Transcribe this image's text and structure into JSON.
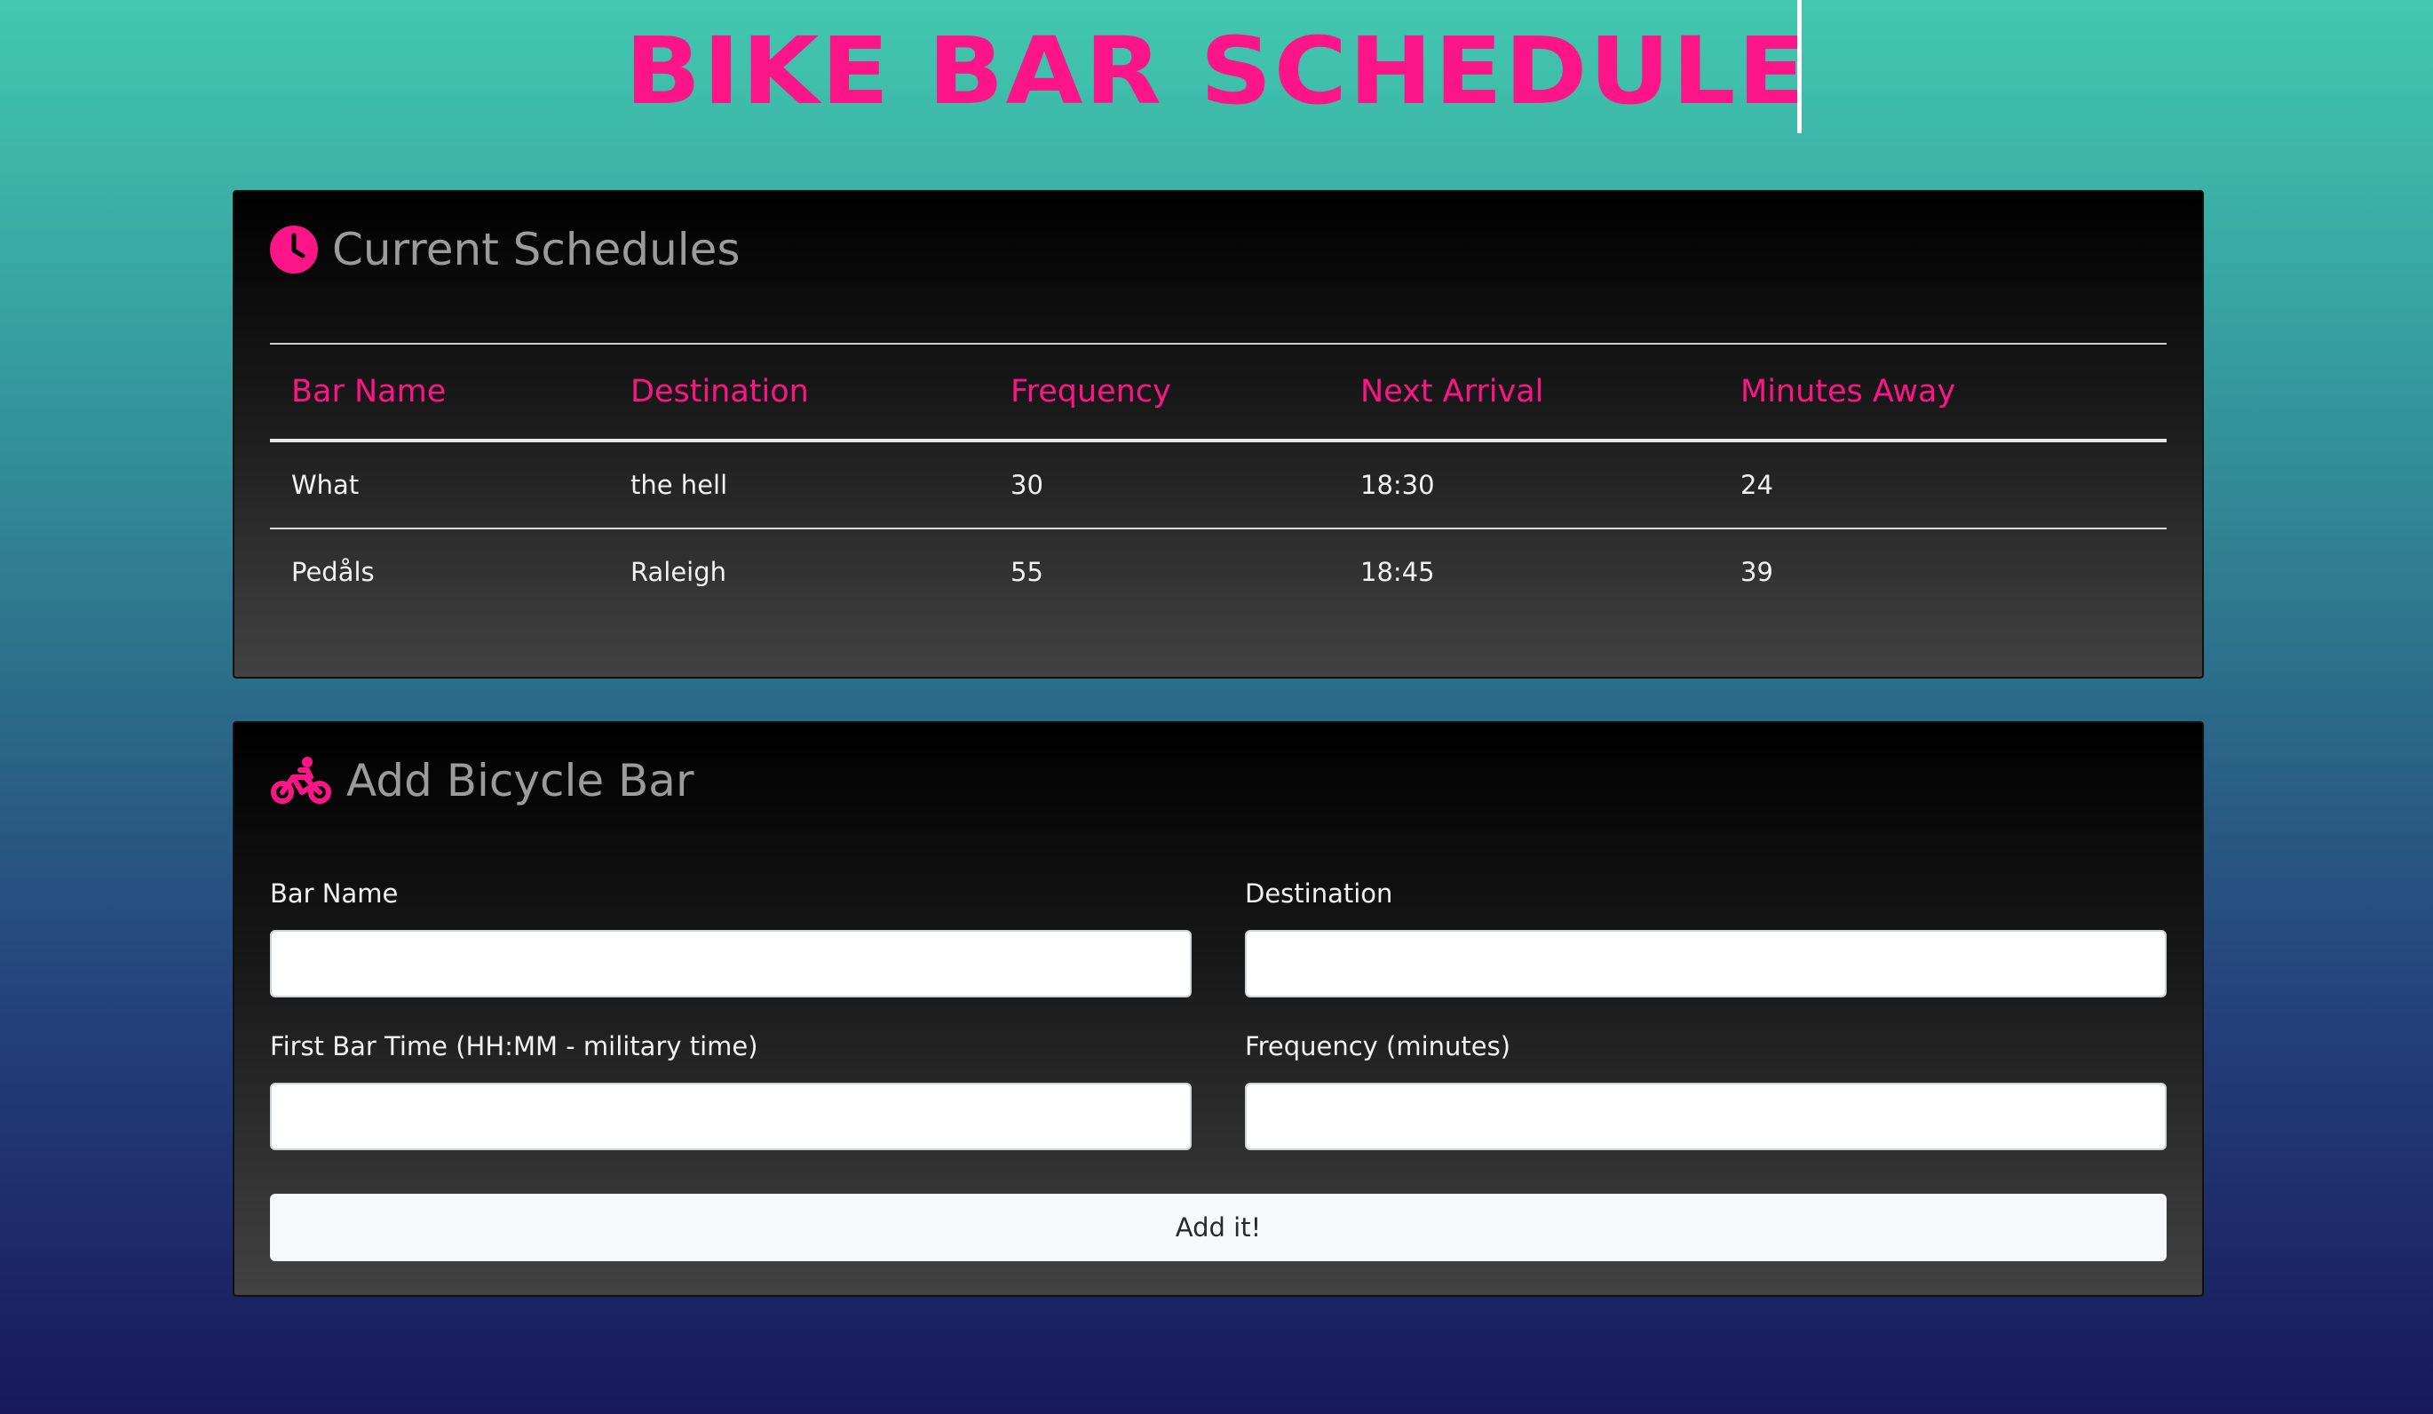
{
  "header": {
    "title": "BIKE BAR SCHEDULE"
  },
  "schedules_panel": {
    "title": "Current Schedules",
    "icon": "clock-icon",
    "columns": [
      "Bar Name",
      "Destination",
      "Frequency",
      "Next Arrival",
      "Minutes Away"
    ],
    "rows": [
      [
        "What",
        "the hell",
        "30",
        "18:30",
        "24"
      ],
      [
        "Pedåls",
        "Raleigh",
        "55",
        "18:45",
        "39"
      ]
    ]
  },
  "add_panel": {
    "title": "Add Bicycle Bar",
    "icon": "bicycle-icon",
    "fields": {
      "bar_name": {
        "label": "Bar Name",
        "value": "",
        "placeholder": ""
      },
      "destination": {
        "label": "Destination",
        "value": "",
        "placeholder": ""
      },
      "first_time": {
        "label": "First Bar Time (HH:MM - military time)",
        "value": "",
        "placeholder": ""
      },
      "frequency": {
        "label": "Frequency (minutes)",
        "value": "",
        "placeholder": ""
      }
    },
    "submit_label": "Add it!"
  },
  "colors": {
    "accent": "#fc1587",
    "panel_text": "#9b9b9b",
    "background_top": "#42c8b0",
    "background_bottom": "#17195a"
  }
}
